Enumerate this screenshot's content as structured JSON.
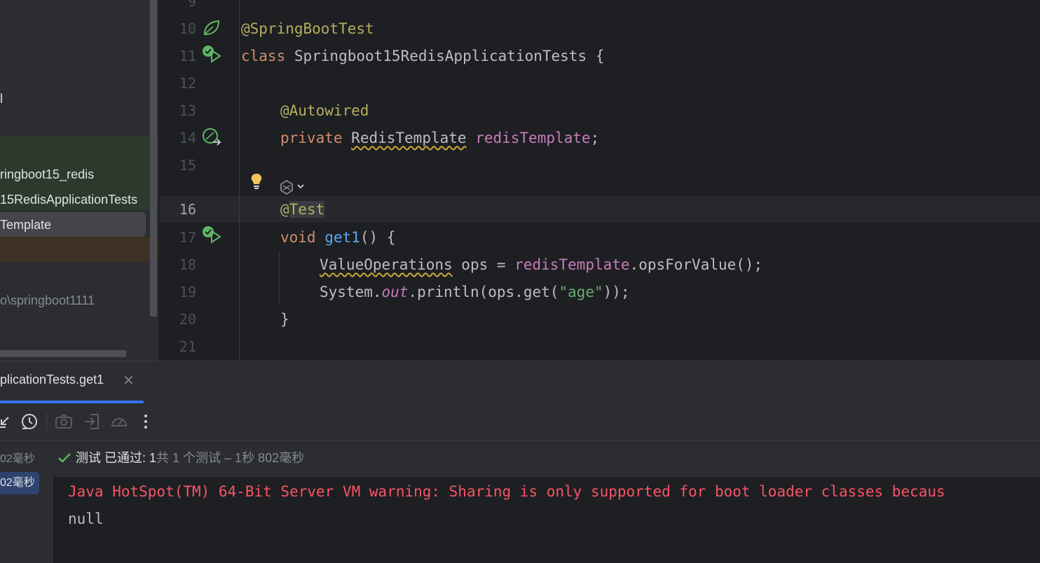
{
  "project_panel": {
    "rows": [
      {
        "text": "l"
      },
      {
        "text": "ringboot15_redis"
      },
      {
        "text": "15RedisApplicationTests"
      },
      {
        "text": "Template"
      },
      {
        "text": "o\\springboot1111"
      }
    ]
  },
  "editor": {
    "line_numbers": [
      "9",
      "10",
      "11",
      "12",
      "13",
      "14",
      "15",
      "16",
      "17",
      "18",
      "19",
      "20",
      "21"
    ],
    "lines": {
      "l10_ann": "@SpringBootTest",
      "l11_kw": "class",
      "l11_name": " Springboot15RedisApplicationTests {",
      "l13_ann": "@Autowired",
      "l14_kw": "private",
      "l14_type": "RedisTemplate",
      "l14_field": "redisTemplate",
      "l14_end": ";",
      "l16_at": "@",
      "l16_name": "Test",
      "l17_kw": "void",
      "l17_fn": "get1",
      "l17_end": "() {",
      "l18_type": "ValueOperations",
      "l18_mid": " ops = ",
      "l18_field": "redisTemplate",
      "l18_end": ".opsForValue();",
      "l19_sys": "System.",
      "l19_out": "out",
      "l19_mid": ".println(ops.get(",
      "l19_str": "\"age\"",
      "l19_end": "));",
      "l20": "}"
    }
  },
  "run_window": {
    "tab_label": "plicationTests.get1",
    "tab_close": "×",
    "tree_times": [
      "02毫秒",
      "02毫秒"
    ],
    "status_label": "测试 已通过: 1",
    "status_detail": "共 1 个测试 – 1秒 802毫秒",
    "console_lines": [
      "Java HotSpot(TM) 64-Bit Server VM warning: Sharing is only supported for boot loader classes becaus",
      "null"
    ]
  },
  "icons": {
    "gutter": [
      "spring-bean-icon",
      "run-test-passed-icon",
      "autowired-navigate-icon",
      "intention-bulb-icon",
      "ai-assistant-icon",
      "run-test-passed-icon"
    ],
    "toolbar": [
      "collapse-icon",
      "history-icon",
      "camera-icon",
      "import-icon",
      "gauge-icon",
      "more-icon"
    ]
  },
  "colors": {
    "keyword": "#cf8e6d",
    "annotation": "#b3ae60",
    "field": "#c77dbb",
    "function": "#56a8f5",
    "string": "#6aab73",
    "error": "#f75464",
    "accent": "#3574f0",
    "pass": "#5fb865"
  }
}
